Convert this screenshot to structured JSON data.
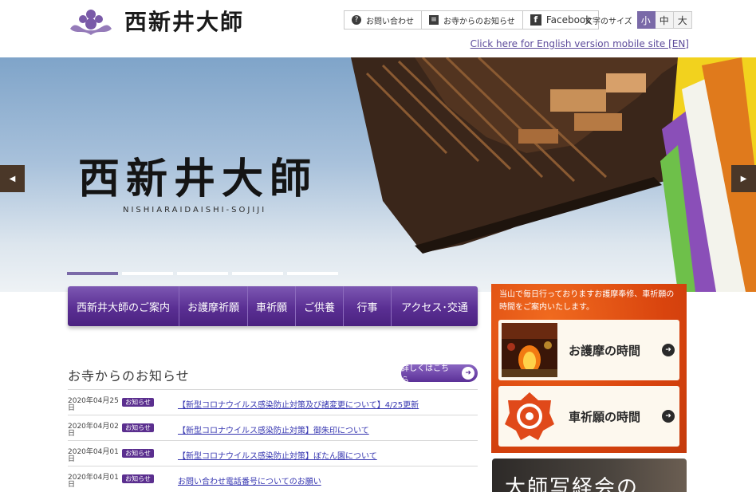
{
  "header": {
    "logo_text": "西新井大師",
    "util_nav": [
      {
        "label": "お問い合わせ",
        "icon": "question-icon"
      },
      {
        "label": "お寺からのお知らせ",
        "icon": "document-icon"
      },
      {
        "label": "Facebook",
        "icon": "facebook-icon"
      }
    ],
    "font_size_label": "文字のサイズ",
    "font_sizes": [
      "小",
      "中",
      "大"
    ],
    "font_size_selected": "小",
    "english_link": "Click here for English version mobile site [EN]"
  },
  "hero": {
    "title": "西新井大師",
    "subtitle": "NISHIARAIDAISHI-SOJIJI",
    "slide_count": 5,
    "active_slide": 1
  },
  "main_nav": [
    "西新井大師のご案内",
    "お護摩祈願",
    "車祈願",
    "ご供養",
    "行事",
    "アクセス･交通"
  ],
  "news": {
    "title": "お寺からのお知らせ",
    "more_label": "詳しくはこちら",
    "items": [
      {
        "date": "2020年04月25日",
        "badge": "お知らせ",
        "text": "【新型コロナウイルス感染防止対策及び諸変更について】4/25更新"
      },
      {
        "date": "2020年04月02日",
        "badge": "お知らせ",
        "text": "【新型コロナウイルス感染防止対策】御朱印について"
      },
      {
        "date": "2020年04月01日",
        "badge": "お知らせ",
        "text": "【新型コロナウイルス感染防止対策】ぼたん園について"
      },
      {
        "date": "2020年04月01日",
        "badge": "お知らせ",
        "text": "お問い合わせ電話番号についてのお願い"
      }
    ]
  },
  "sidebar": {
    "intro": "当山で毎日行っておりますお護摩奉修、車祈願の時間をご案内いたします。",
    "cards": [
      {
        "label": "お護摩の時間"
      },
      {
        "label": "車祈願の時間"
      }
    ],
    "banner_text": "大師写経会の"
  },
  "colors": {
    "brand_purple": "#5a2f93",
    "accent_orange": "#d9440e",
    "link_blue": "#3535b0"
  }
}
